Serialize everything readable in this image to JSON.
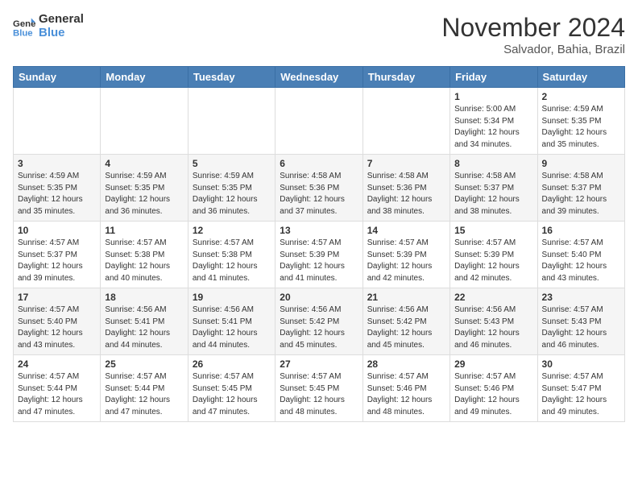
{
  "header": {
    "logo_line1": "General",
    "logo_line2": "Blue",
    "month": "November 2024",
    "location": "Salvador, Bahia, Brazil"
  },
  "weekdays": [
    "Sunday",
    "Monday",
    "Tuesday",
    "Wednesday",
    "Thursday",
    "Friday",
    "Saturday"
  ],
  "weeks": [
    [
      {
        "day": "",
        "info": ""
      },
      {
        "day": "",
        "info": ""
      },
      {
        "day": "",
        "info": ""
      },
      {
        "day": "",
        "info": ""
      },
      {
        "day": "",
        "info": ""
      },
      {
        "day": "1",
        "info": "Sunrise: 5:00 AM\nSunset: 5:34 PM\nDaylight: 12 hours\nand 34 minutes."
      },
      {
        "day": "2",
        "info": "Sunrise: 4:59 AM\nSunset: 5:35 PM\nDaylight: 12 hours\nand 35 minutes."
      }
    ],
    [
      {
        "day": "3",
        "info": "Sunrise: 4:59 AM\nSunset: 5:35 PM\nDaylight: 12 hours\nand 35 minutes."
      },
      {
        "day": "4",
        "info": "Sunrise: 4:59 AM\nSunset: 5:35 PM\nDaylight: 12 hours\nand 36 minutes."
      },
      {
        "day": "5",
        "info": "Sunrise: 4:59 AM\nSunset: 5:35 PM\nDaylight: 12 hours\nand 36 minutes."
      },
      {
        "day": "6",
        "info": "Sunrise: 4:58 AM\nSunset: 5:36 PM\nDaylight: 12 hours\nand 37 minutes."
      },
      {
        "day": "7",
        "info": "Sunrise: 4:58 AM\nSunset: 5:36 PM\nDaylight: 12 hours\nand 38 minutes."
      },
      {
        "day": "8",
        "info": "Sunrise: 4:58 AM\nSunset: 5:37 PM\nDaylight: 12 hours\nand 38 minutes."
      },
      {
        "day": "9",
        "info": "Sunrise: 4:58 AM\nSunset: 5:37 PM\nDaylight: 12 hours\nand 39 minutes."
      }
    ],
    [
      {
        "day": "10",
        "info": "Sunrise: 4:57 AM\nSunset: 5:37 PM\nDaylight: 12 hours\nand 39 minutes."
      },
      {
        "day": "11",
        "info": "Sunrise: 4:57 AM\nSunset: 5:38 PM\nDaylight: 12 hours\nand 40 minutes."
      },
      {
        "day": "12",
        "info": "Sunrise: 4:57 AM\nSunset: 5:38 PM\nDaylight: 12 hours\nand 41 minutes."
      },
      {
        "day": "13",
        "info": "Sunrise: 4:57 AM\nSunset: 5:39 PM\nDaylight: 12 hours\nand 41 minutes."
      },
      {
        "day": "14",
        "info": "Sunrise: 4:57 AM\nSunset: 5:39 PM\nDaylight: 12 hours\nand 42 minutes."
      },
      {
        "day": "15",
        "info": "Sunrise: 4:57 AM\nSunset: 5:39 PM\nDaylight: 12 hours\nand 42 minutes."
      },
      {
        "day": "16",
        "info": "Sunrise: 4:57 AM\nSunset: 5:40 PM\nDaylight: 12 hours\nand 43 minutes."
      }
    ],
    [
      {
        "day": "17",
        "info": "Sunrise: 4:57 AM\nSunset: 5:40 PM\nDaylight: 12 hours\nand 43 minutes."
      },
      {
        "day": "18",
        "info": "Sunrise: 4:56 AM\nSunset: 5:41 PM\nDaylight: 12 hours\nand 44 minutes."
      },
      {
        "day": "19",
        "info": "Sunrise: 4:56 AM\nSunset: 5:41 PM\nDaylight: 12 hours\nand 44 minutes."
      },
      {
        "day": "20",
        "info": "Sunrise: 4:56 AM\nSunset: 5:42 PM\nDaylight: 12 hours\nand 45 minutes."
      },
      {
        "day": "21",
        "info": "Sunrise: 4:56 AM\nSunset: 5:42 PM\nDaylight: 12 hours\nand 45 minutes."
      },
      {
        "day": "22",
        "info": "Sunrise: 4:56 AM\nSunset: 5:43 PM\nDaylight: 12 hours\nand 46 minutes."
      },
      {
        "day": "23",
        "info": "Sunrise: 4:57 AM\nSunset: 5:43 PM\nDaylight: 12 hours\nand 46 minutes."
      }
    ],
    [
      {
        "day": "24",
        "info": "Sunrise: 4:57 AM\nSunset: 5:44 PM\nDaylight: 12 hours\nand 47 minutes."
      },
      {
        "day": "25",
        "info": "Sunrise: 4:57 AM\nSunset: 5:44 PM\nDaylight: 12 hours\nand 47 minutes."
      },
      {
        "day": "26",
        "info": "Sunrise: 4:57 AM\nSunset: 5:45 PM\nDaylight: 12 hours\nand 47 minutes."
      },
      {
        "day": "27",
        "info": "Sunrise: 4:57 AM\nSunset: 5:45 PM\nDaylight: 12 hours\nand 48 minutes."
      },
      {
        "day": "28",
        "info": "Sunrise: 4:57 AM\nSunset: 5:46 PM\nDaylight: 12 hours\nand 48 minutes."
      },
      {
        "day": "29",
        "info": "Sunrise: 4:57 AM\nSunset: 5:46 PM\nDaylight: 12 hours\nand 49 minutes."
      },
      {
        "day": "30",
        "info": "Sunrise: 4:57 AM\nSunset: 5:47 PM\nDaylight: 12 hours\nand 49 minutes."
      }
    ]
  ]
}
